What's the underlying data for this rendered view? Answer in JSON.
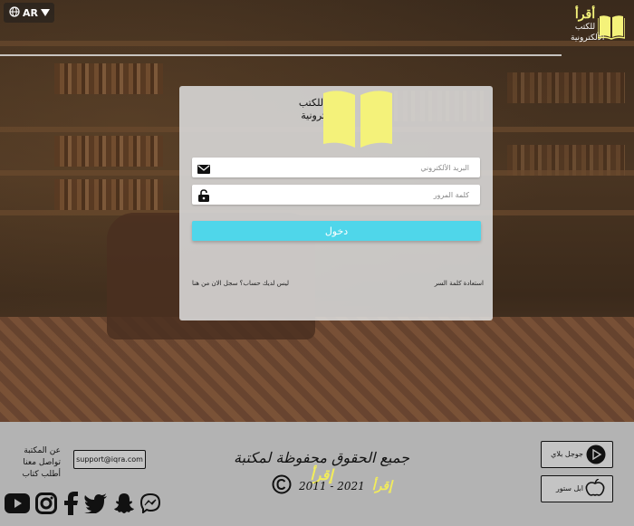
{
  "header": {
    "language": "AR",
    "logo_title": "أقرأ",
    "logo_line2": "للكتب",
    "logo_line3": "الألكترونية"
  },
  "login_card": {
    "brand_line1": "أقرأ للكتب",
    "brand_line2": "الألكترونية",
    "email_placeholder": "البريد الألكتروني",
    "password_placeholder": "كلمة المرور",
    "login_label": "دخول",
    "forgot_password": "استعادة كلمة السر",
    "signup_prompt": "ليس لديك حساب؟ سجل الان من هنا"
  },
  "footer": {
    "links": [
      "عن المكتبة",
      "تواصل معنا",
      "أطلب كتاب"
    ],
    "email": "support@iqra.com",
    "rights_text": "جميع الحقوق محفوظة لمكتبة",
    "rights_brand": "إقرأ",
    "years": "2011 - 2021",
    "years_brand": "إقرأ",
    "google_play": "جوجل بلاي",
    "app_store": "ابل ستور",
    "social_icons": [
      "youtube-icon",
      "instagram-icon",
      "facebook-icon",
      "twitter-icon",
      "snapchat-icon",
      "messenger-icon"
    ]
  },
  "colors": {
    "accent": "#4fd6ea",
    "brand_yellow": "#f4f27a",
    "footer_bg": "#b3b3b3"
  }
}
